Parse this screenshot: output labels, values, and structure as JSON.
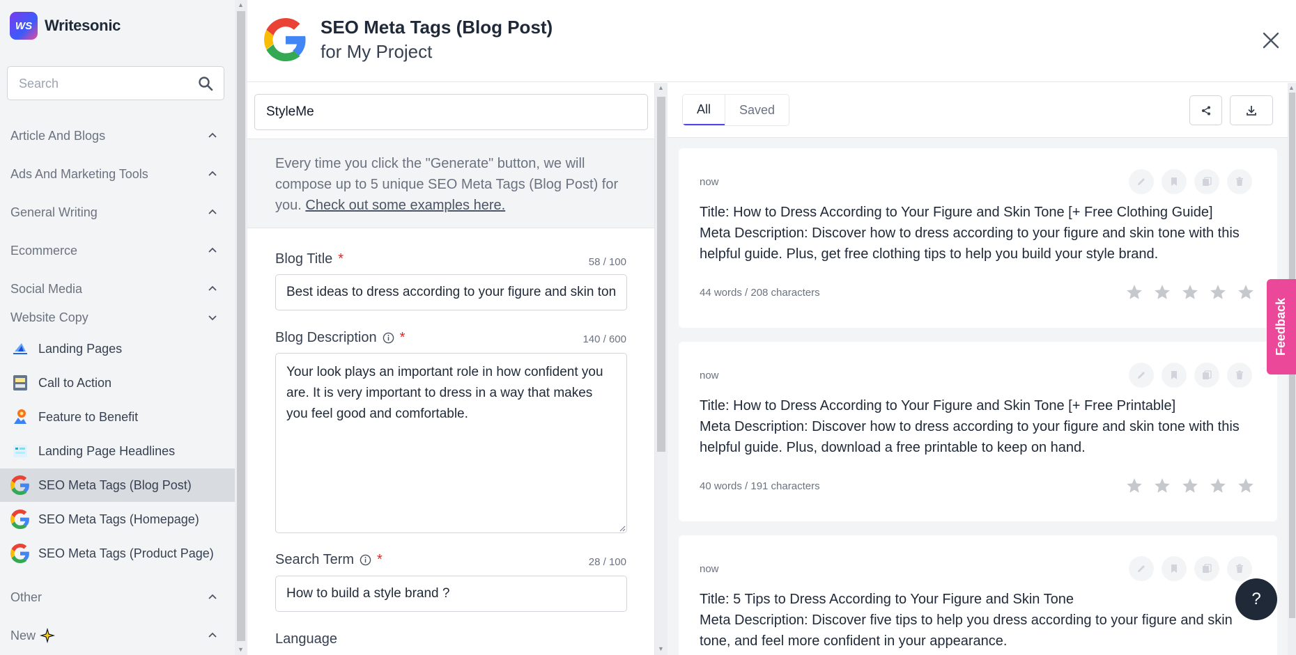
{
  "app": {
    "name": "Writesonic",
    "logo_text": "WS"
  },
  "search": {
    "placeholder": "Search"
  },
  "sidebar": {
    "categories": [
      {
        "label": "Article And Blogs",
        "expanded": false
      },
      {
        "label": "Ads And Marketing Tools",
        "expanded": false
      },
      {
        "label": "General Writing",
        "expanded": false
      },
      {
        "label": "Ecommerce",
        "expanded": false
      },
      {
        "label": "Social Media",
        "expanded": false
      },
      {
        "label": "Website Copy",
        "expanded": true
      }
    ],
    "items": [
      {
        "label": "Landing Pages",
        "icon": "landing-pages-icon"
      },
      {
        "label": "Call to Action",
        "icon": "call-to-action-icon"
      },
      {
        "label": "Feature to Benefit",
        "icon": "feature-to-benefit-icon"
      },
      {
        "label": "Landing Page Headlines",
        "icon": "landing-page-headlines-icon"
      },
      {
        "label": "SEO Meta Tags (Blog Post)",
        "icon": "google-icon",
        "active": true
      },
      {
        "label": "SEO Meta Tags (Homepage)",
        "icon": "google-icon"
      },
      {
        "label": "SEO Meta Tags (Product Page)",
        "icon": "google-icon"
      }
    ],
    "footer_categories": [
      {
        "label": "Other",
        "expanded": false
      },
      {
        "label": "New",
        "expanded": false,
        "badge_icon": "sparkle-icon"
      }
    ]
  },
  "header": {
    "title": "SEO Meta Tags (Blog Post)",
    "subtitle": "for My Project"
  },
  "form": {
    "project_name": "StyleMe",
    "intro_text": "Every time you click the \"Generate\" button, we will compose up to 5 unique SEO Meta Tags (Blog Post) for you.",
    "intro_link": "Check out some examples here.",
    "fields": {
      "blog_title": {
        "label": "Blog Title",
        "required": "*",
        "count": "58 / 100",
        "value": "Best ideas to dress according to your figure and skin tone"
      },
      "blog_description": {
        "label": "Blog Description",
        "required": "*",
        "count": "140 / 600",
        "value": "Your look plays an important role in how confident you are. It is very important to dress in a way that makes you feel good and comfortable."
      },
      "search_term": {
        "label": "Search Term",
        "required": "*",
        "count": "28 / 100",
        "value": "How to build a style brand ?"
      },
      "language": {
        "label": "Language"
      }
    }
  },
  "results": {
    "tabs": [
      "All",
      "Saved"
    ],
    "active_tab": "All",
    "items": [
      {
        "time": "now",
        "title_line": "Title: How to Dress According to Your Figure and Skin Tone [+ Free Clothing Guide]",
        "desc_line": "Meta Description: Discover how to dress according to your figure and skin tone with this helpful guide. Plus, get free clothing tips to help you build your style brand.",
        "stats": "44 words / 208 characters"
      },
      {
        "time": "now",
        "title_line": "Title: How to Dress According to Your Figure and Skin Tone [+ Free Printable]",
        "desc_line": "Meta Description: Discover how to dress according to your figure and skin tone with this helpful guide. Plus, download a free printable to keep on hand.",
        "stats": "40 words / 191 characters"
      },
      {
        "time": "now",
        "title_line": "Title: 5 Tips to Dress According to Your Figure and Skin Tone",
        "desc_line": "Meta Description: Discover five tips to help you dress according to your figure and skin tone, and feel more confident in your appearance.",
        "stats": ""
      }
    ]
  },
  "feedback": {
    "label": "Feedback"
  },
  "help": {
    "label": "?"
  },
  "colors": {
    "accent": "#4f46e5",
    "feedback": "#ec4899",
    "help_bg": "#1f2937",
    "required": "#dc2626"
  }
}
